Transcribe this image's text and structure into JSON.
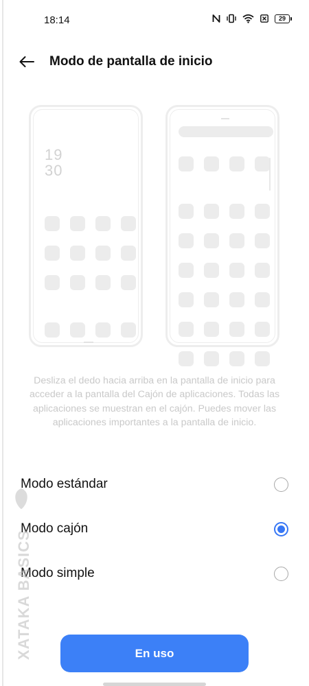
{
  "status_bar": {
    "time": "18:14",
    "icons": [
      "nfc-icon",
      "vibrate-icon",
      "wifi-icon",
      "sim-off-icon",
      "battery-icon"
    ],
    "battery_level": "29"
  },
  "header": {
    "back_icon": "arrow-left-icon",
    "title": "Modo de pantalla de inicio"
  },
  "preview": {
    "clock_hour": "19",
    "clock_minute": "30"
  },
  "description": "Desliza el dedo hacia arriba en la pantalla de inicio para acceder a la pantalla del Cajón de aplicaciones. Todas las aplicaciones se muestran en el cajón. Puedes mover las aplicaciones importantes a la pantalla de inicio.",
  "options": [
    {
      "label": "Modo estándar",
      "selected": false
    },
    {
      "label": "Modo cajón",
      "selected": true
    },
    {
      "label": "Modo simple",
      "selected": false
    }
  ],
  "button": {
    "label": "En uso"
  },
  "watermark": {
    "text": "XATAKA BASICS"
  },
  "colors": {
    "accent": "#3777f5",
    "button": "#3c80f7",
    "description_text": "#c9c9c9",
    "placeholder": "#ececec"
  }
}
